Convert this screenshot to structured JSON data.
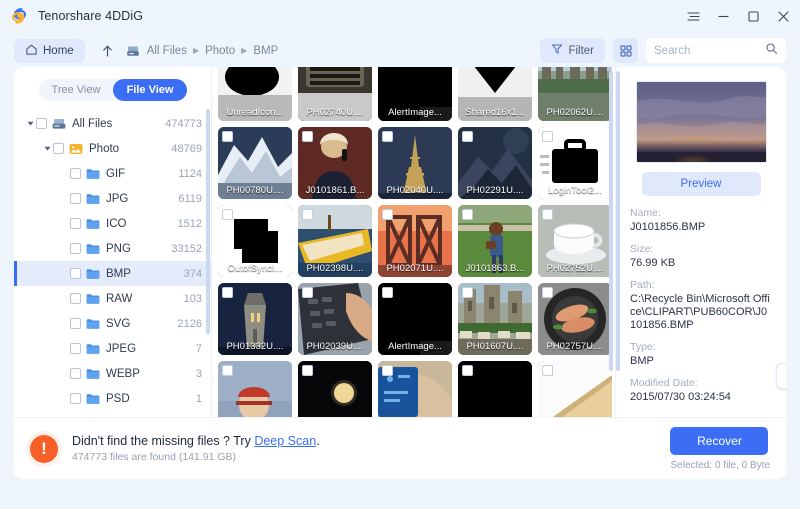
{
  "window": {
    "app_title": "Tenorshare 4DDiG",
    "logo_icon": "4ddig-logo-icon",
    "menu_icon": "menu-icon",
    "minimize_icon": "minimize-icon",
    "maximize_icon": "maximize-icon",
    "close_icon": "close-icon"
  },
  "toolbar": {
    "home_label": "Home",
    "home_icon": "home-icon",
    "up_icon": "arrow-up-icon",
    "disk_icon": "disk-icon",
    "breadcrumbs": [
      "All Files",
      "Photo",
      "BMP"
    ],
    "filter_label": "Filter",
    "filter_icon": "funnel-icon",
    "grid_icon": "grid-view-icon",
    "search_placeholder": "Search",
    "search_value": "",
    "search_icon": "search-icon"
  },
  "sidebar": {
    "view_toggle": {
      "tree_label": "Tree View",
      "file_label": "File View",
      "active": "File View"
    },
    "items": [
      {
        "label": "All Files",
        "count": "474773",
        "depth": 0,
        "icon": "disk-icon",
        "caret": true,
        "expanded": true,
        "checkbox": true,
        "selected": false
      },
      {
        "label": "Photo",
        "count": "48769",
        "depth": 1,
        "icon": "photo-folder-icon",
        "caret": true,
        "expanded": true,
        "checkbox": true,
        "selected": false
      },
      {
        "label": "GIF",
        "count": "1124",
        "depth": 2,
        "icon": "folder-icon",
        "caret": false,
        "checkbox": true,
        "selected": false
      },
      {
        "label": "JPG",
        "count": "6119",
        "depth": 2,
        "icon": "folder-icon",
        "caret": false,
        "checkbox": true,
        "selected": false
      },
      {
        "label": "ICO",
        "count": "1512",
        "depth": 2,
        "icon": "folder-icon",
        "caret": false,
        "checkbox": true,
        "selected": false
      },
      {
        "label": "PNG",
        "count": "33152",
        "depth": 2,
        "icon": "folder-icon",
        "caret": false,
        "checkbox": true,
        "selected": false
      },
      {
        "label": "BMP",
        "count": "374",
        "depth": 2,
        "icon": "folder-icon",
        "caret": false,
        "checkbox": true,
        "selected": true
      },
      {
        "label": "RAW",
        "count": "103",
        "depth": 2,
        "icon": "folder-icon",
        "caret": false,
        "checkbox": true,
        "selected": false
      },
      {
        "label": "SVG",
        "count": "2126",
        "depth": 2,
        "icon": "folder-icon",
        "caret": false,
        "checkbox": true,
        "selected": false
      },
      {
        "label": "JPEG",
        "count": "7",
        "depth": 2,
        "icon": "folder-icon",
        "caret": false,
        "checkbox": true,
        "selected": false
      },
      {
        "label": "WEBP",
        "count": "3",
        "depth": 2,
        "icon": "folder-icon",
        "caret": false,
        "checkbox": true,
        "selected": false
      },
      {
        "label": "PSD",
        "count": "1",
        "depth": 2,
        "icon": "folder-icon",
        "caret": false,
        "checkbox": true,
        "selected": false
      }
    ]
  },
  "grid": {
    "tiles": [
      {
        "name": "UnreadIcon...",
        "row": 0,
        "thumb": "black-blob-on-gray",
        "checkbox": false
      },
      {
        "name": "PH02740U....",
        "row": 0,
        "thumb": "dark-machine",
        "checkbox": false
      },
      {
        "name": "AlertImage...",
        "row": 0,
        "thumb": "black",
        "checkbox": false
      },
      {
        "name": "Shared16x1...",
        "row": 0,
        "thumb": "black-triangle-on-gray",
        "checkbox": false
      },
      {
        "name": "PH02062U....",
        "row": 0,
        "thumb": "city-skyline",
        "checkbox": false
      },
      {
        "name": "PH00780U....",
        "row": 1,
        "thumb": "snow-mountain",
        "checkbox": true
      },
      {
        "name": "J0101861.B...",
        "row": 1,
        "thumb": "woman-on-phone",
        "checkbox": true
      },
      {
        "name": "PH02040U....",
        "row": 1,
        "thumb": "eiffel-tower",
        "checkbox": true
      },
      {
        "name": "PH02291U....",
        "row": 1,
        "thumb": "night-mountain",
        "checkbox": true
      },
      {
        "name": "LoginTool2...",
        "row": 1,
        "thumb": "black-briefcase",
        "checkbox": true
      },
      {
        "name": "OutofSyncI...",
        "row": 2,
        "thumb": "black-blob",
        "checkbox": true
      },
      {
        "name": "PH02398U....",
        "row": 2,
        "thumb": "yellow-boat",
        "checkbox": true
      },
      {
        "name": "PH02071U....",
        "row": 2,
        "thumb": "bridge-sunset",
        "checkbox": true
      },
      {
        "name": "J0101863.B...",
        "row": 2,
        "thumb": "woman-running-field",
        "checkbox": true
      },
      {
        "name": "PH02752U....",
        "row": 2,
        "thumb": "white-cup",
        "checkbox": true
      },
      {
        "name": "PH01332U....",
        "row": 3,
        "thumb": "night-tower",
        "checkbox": true
      },
      {
        "name": "PH02039U....",
        "row": 3,
        "thumb": "hand-calculator",
        "checkbox": true
      },
      {
        "name": "AlertImage...",
        "row": 3,
        "thumb": "black",
        "checkbox": true
      },
      {
        "name": "PH01607U....",
        "row": 3,
        "thumb": "castle-crowd",
        "checkbox": true
      },
      {
        "name": "PH02757U....",
        "row": 3,
        "thumb": "salmon-plate",
        "checkbox": true
      },
      {
        "name": "",
        "row": 4,
        "thumb": "person-red-cap",
        "checkbox": true
      },
      {
        "name": "",
        "row": 4,
        "thumb": "moon-night",
        "checkbox": true
      },
      {
        "name": "",
        "row": 4,
        "thumb": "blue-screen-hand",
        "checkbox": true
      },
      {
        "name": "",
        "row": 4,
        "thumb": "black",
        "checkbox": true
      },
      {
        "name": "",
        "row": 4,
        "thumb": "beige-paper",
        "checkbox": true
      }
    ]
  },
  "details": {
    "preview_label": "Preview",
    "preview_thumb": "sunset-clouds",
    "fields": [
      {
        "key": "Name:",
        "value": "J0101856.BMP"
      },
      {
        "key": "Size:",
        "value": "76.99 KB"
      },
      {
        "key": "Path:",
        "value": "C:\\Recycle Bin\\Microsoft Office\\CLIPART\\PUB60COR\\J0101856.BMP"
      },
      {
        "key": "Type:",
        "value": "BMP"
      },
      {
        "key": "Modified Date:",
        "value": "2015/07/30 03:24:54"
      }
    ],
    "next_icon": "chevron-right-icon"
  },
  "bottom": {
    "warn_icon": "alert-exclamation-icon",
    "message_prefix": "Didn't find the missing files ? Try ",
    "message_link": "Deep Scan",
    "message_suffix": ".",
    "substatus": "474773 files are found (141.91 GB)",
    "recover_label": "Recover",
    "selected_info": "Selected: 0 file, 0 Byte"
  },
  "colors": {
    "accent": "#3b6ef5",
    "accent_soft": "#dfe9fb",
    "warn": "#f8602a",
    "page_bg": "#eef5fd"
  }
}
